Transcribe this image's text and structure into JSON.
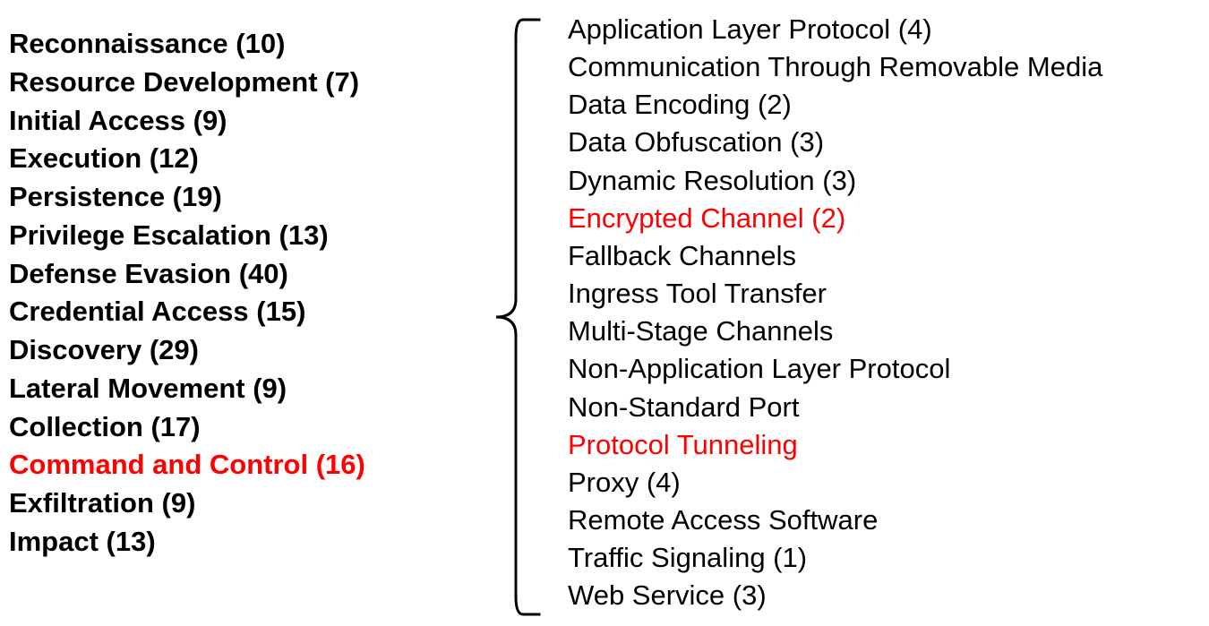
{
  "colors": {
    "highlight": "#ff0000",
    "text": "#000000"
  },
  "tactics": [
    {
      "label": "Reconnaissance (10)",
      "highlighted": false
    },
    {
      "label": "Resource Development (7)",
      "highlighted": false
    },
    {
      "label": "Initial Access (9)",
      "highlighted": false
    },
    {
      "label": "Execution (12)",
      "highlighted": false
    },
    {
      "label": "Persistence (19)",
      "highlighted": false
    },
    {
      "label": "Privilege Escalation (13)",
      "highlighted": false
    },
    {
      "label": "Defense Evasion (40)",
      "highlighted": false
    },
    {
      "label": "Credential Access (15)",
      "highlighted": false
    },
    {
      "label": "Discovery (29)",
      "highlighted": false
    },
    {
      "label": "Lateral Movement (9)",
      "highlighted": false
    },
    {
      "label": "Collection (17)",
      "highlighted": false
    },
    {
      "label": "Command and Control (16)",
      "highlighted": true
    },
    {
      "label": "Exfiltration (9)",
      "highlighted": false
    },
    {
      "label": "Impact (13)",
      "highlighted": false
    }
  ],
  "techniques": [
    {
      "label": "Application Layer Protocol (4)",
      "highlighted": false
    },
    {
      "label": "Communication Through Removable Media",
      "highlighted": false
    },
    {
      "label": "Data Encoding (2)",
      "highlighted": false
    },
    {
      "label": "Data Obfuscation (3)",
      "highlighted": false
    },
    {
      "label": "Dynamic Resolution (3)",
      "highlighted": false
    },
    {
      "label": "Encrypted Channel (2)",
      "highlighted": true
    },
    {
      "label": "Fallback Channels",
      "highlighted": false
    },
    {
      "label": "Ingress Tool Transfer",
      "highlighted": false
    },
    {
      "label": "Multi-Stage Channels",
      "highlighted": false
    },
    {
      "label": "Non-Application Layer Protocol",
      "highlighted": false
    },
    {
      "label": "Non-Standard Port",
      "highlighted": false
    },
    {
      "label": "Protocol Tunneling",
      "highlighted": true
    },
    {
      "label": "Proxy (4)",
      "highlighted": false
    },
    {
      "label": "Remote Access Software",
      "highlighted": false
    },
    {
      "label": "Traffic Signaling (1)",
      "highlighted": false
    },
    {
      "label": "Web Service (3)",
      "highlighted": false
    }
  ]
}
